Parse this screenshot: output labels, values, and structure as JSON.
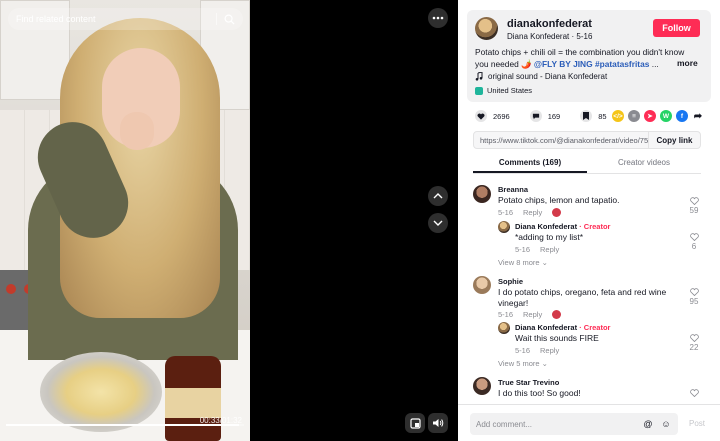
{
  "player": {
    "search_placeholder": "Find related content",
    "progress": 0.98,
    "timecode": "00:33/01:32"
  },
  "post": {
    "username": "dianakonfederat",
    "display_name": "Diana Konfederat",
    "date": "5-16",
    "follow_label": "Follow",
    "description_start": "Potato chips + chili oil = the combination you didn't know you needed ",
    "description_emoji": "🌶️",
    "mention": "@FLY BY JING",
    "hashtag": "#patatasfritas",
    "ellipsis": " ...",
    "more_label": "more",
    "sound": "original sound - Diana Konfederat",
    "location": "United States"
  },
  "stats": {
    "likes": "2696",
    "comments": "169",
    "saves": "85"
  },
  "share_icons": [
    {
      "name": "embed",
      "color": "#f5c518",
      "glyph": "</>"
    },
    {
      "name": "friends",
      "color": "#8a8b91",
      "glyph": "≡"
    },
    {
      "name": "send",
      "color": "#fe2c55",
      "glyph": "➤"
    },
    {
      "name": "whatsapp",
      "color": "#25d366",
      "glyph": "W"
    },
    {
      "name": "facebook",
      "color": "#1877f2",
      "glyph": "f"
    }
  ],
  "link": {
    "url": "https://www.tiktok.com/@dianakonfederat/video/750...",
    "copy_label": "Copy link"
  },
  "tabs": {
    "comments": "Comments (169)",
    "creator_videos": "Creator videos"
  },
  "comments": [
    {
      "name": "Breanna",
      "text": "Potato chips, lemon and tapatio.",
      "date": "5-16",
      "reply_label": "Reply",
      "likes": "59",
      "reply": {
        "name": "Diana Konfederat",
        "creator_tag": "Creator",
        "text": "*adding to my list*",
        "date": "5-16",
        "reply_label": "Reply",
        "likes": "6"
      },
      "view_more": "View 8 more"
    },
    {
      "name": "Sophie",
      "text": "I do potato chips, oregano, feta and red wine vinegar!",
      "date": "5-16",
      "reply_label": "Reply",
      "likes": "95",
      "reply": {
        "name": "Diana Konfederat",
        "creator_tag": "Creator",
        "text": "Wait this sounds FIRE",
        "date": "5-16",
        "reply_label": "Reply",
        "likes": "22"
      },
      "view_more": "View 5 more"
    },
    {
      "name": "True Star Trevino",
      "text": "I do this too! So good!"
    }
  ],
  "composer": {
    "placeholder": "Add comment...",
    "post_label": "Post"
  }
}
